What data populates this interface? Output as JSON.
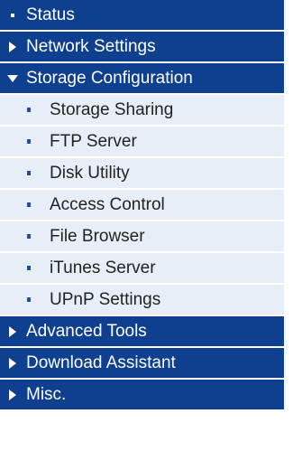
{
  "colors": {
    "header_bg": "#0f3f8f",
    "header_text": "#ffffff",
    "subitem_bg": "#e8eef7",
    "subitem_text": "#222222",
    "subitem_bullet": "#1f4ea3"
  },
  "menu": {
    "status": {
      "label": "Status",
      "icon": "bullet-icon"
    },
    "network_settings": {
      "label": "Network Settings",
      "icon": "chevron-right-icon"
    },
    "storage_configuration": {
      "label": "Storage Configuration",
      "icon": "chevron-down-icon",
      "expanded": true,
      "items": [
        {
          "label": "Storage Sharing",
          "icon": "bullet-icon"
        },
        {
          "label": "FTP Server",
          "icon": "bullet-icon"
        },
        {
          "label": "Disk Utility",
          "icon": "bullet-icon"
        },
        {
          "label": "Access Control",
          "icon": "bullet-icon"
        },
        {
          "label": "File Browser",
          "icon": "bullet-icon"
        },
        {
          "label": "iTunes Server",
          "icon": "bullet-icon"
        },
        {
          "label": "UPnP Settings",
          "icon": "bullet-icon"
        }
      ]
    },
    "advanced_tools": {
      "label": "Advanced Tools",
      "icon": "chevron-right-icon"
    },
    "download_assistant": {
      "label": "Download Assistant",
      "icon": "chevron-right-icon"
    },
    "misc": {
      "label": "Misc.",
      "icon": "chevron-right-icon"
    }
  }
}
